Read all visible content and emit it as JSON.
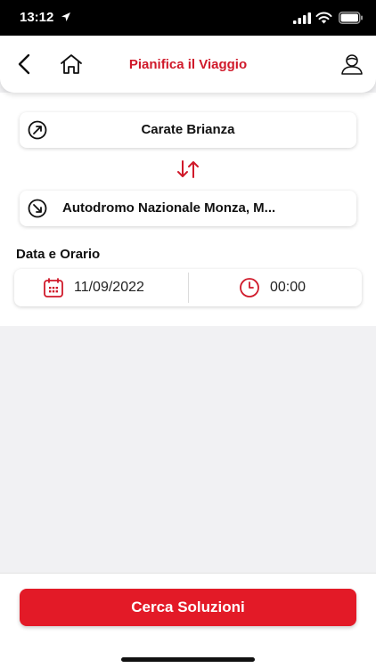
{
  "status_bar": {
    "time": "13:12"
  },
  "header": {
    "title": "Pianifica il Viaggio"
  },
  "trip": {
    "origin": "Carate Brianza",
    "destination": "Autodromo Nazionale Monza, M..."
  },
  "datetime": {
    "section_label": "Data e Orario",
    "date": "11/09/2022",
    "time": "00:00"
  },
  "actions": {
    "search_label": "Cerca Soluzioni"
  },
  "colors": {
    "accent": "#d0192a",
    "button": "#e31a27"
  },
  "icons": {
    "back": "chevron-left-icon",
    "home": "home-icon",
    "profile": "user-icon",
    "origin": "arrow-up-right-circle-icon",
    "destination": "arrow-down-right-circle-icon",
    "swap": "swap-vertical-icon",
    "date": "calendar-icon",
    "time": "clock-icon"
  }
}
